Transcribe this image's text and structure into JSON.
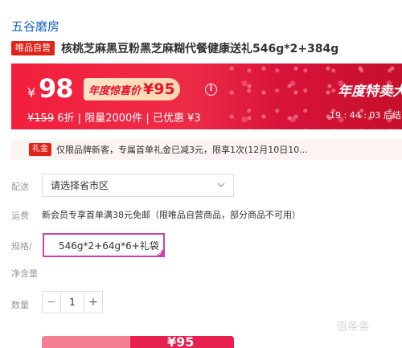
{
  "brand": {
    "name": "五谷磨房"
  },
  "product": {
    "self_operated_badge": "唯品自营",
    "title": "核桃芝麻黑豆粉黑芝麻糊代餐健康送礼546g*2+384g"
  },
  "price_banner": {
    "currency": "¥",
    "price": "98",
    "annual_label": "年度惊喜价",
    "annual_price": "¥95",
    "info_icon": "info-icon",
    "original_price": "¥159",
    "discount": "6折",
    "limit": "限量2000件",
    "saved": "已优惠 ¥3",
    "separator": "|",
    "right_title": "年度特卖大",
    "countdown": "19 : 44 : 03  后结",
    "colors": {
      "banner": "#ee2b47",
      "tag_bg": "#ffdcb8",
      "tag_text": "#e0142f"
    }
  },
  "coupon": {
    "badge": "礼金",
    "text": "仅限品牌新客，专属首单礼金已减3元，限享1次(12月10日10..."
  },
  "delivery": {
    "label": "配送",
    "placeholder": "请选择省市区",
    "chevron_icon": "chevron-down-icon"
  },
  "shipping": {
    "label": "运费",
    "text": "新会员专享首单满38元免邮（限唯品自营商品，部分商品不可用）"
  },
  "spec": {
    "label_line1": "规格/",
    "label_line2": "净含量",
    "option": "546g*2+64g*6+礼袋",
    "selected_color": "#d23dac"
  },
  "quantity": {
    "label": "数量",
    "minus": "−",
    "value": "1",
    "plus": "+"
  },
  "buy": {
    "left_label": "",
    "right_price": "¥95",
    "colors": {
      "left": "#f47e93",
      "right": "#e8204f"
    }
  },
  "watermark": "值条条"
}
